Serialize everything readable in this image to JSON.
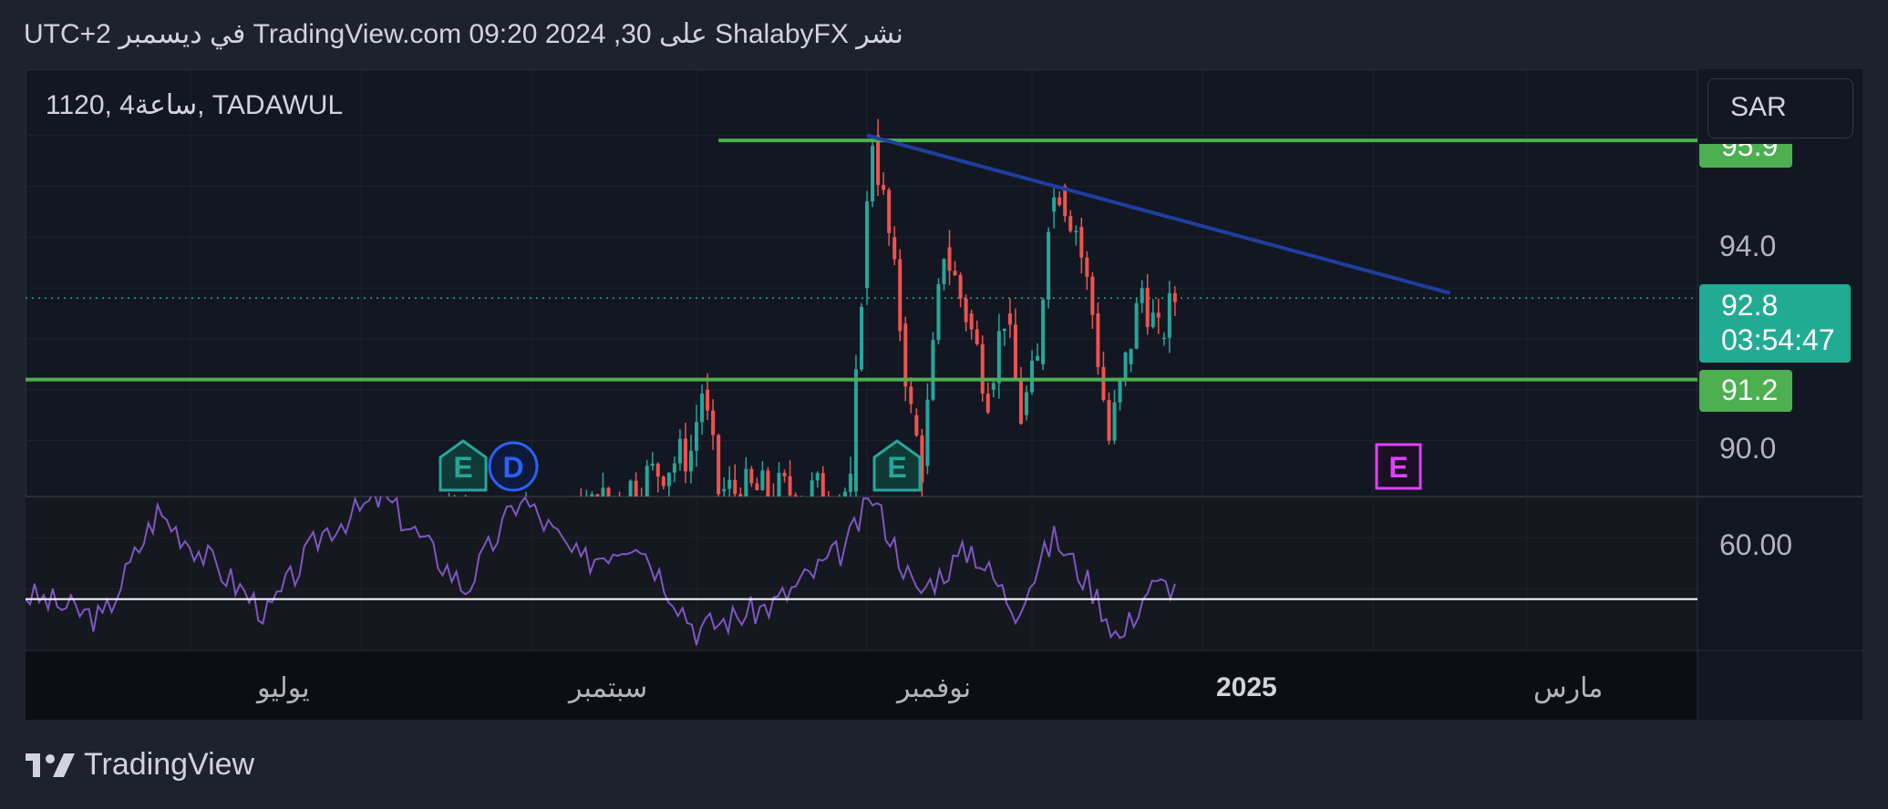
{
  "header": {
    "text": "نشر ShalabyFX على TradingView.com 09:20 2024 ,30 في ديسمبر UTC+2"
  },
  "symbol": {
    "label": "1120, 4ساعة, TADAWUL"
  },
  "currency": {
    "label": "SAR"
  },
  "price_axis": {
    "ticks": [
      "94.0",
      "90.0"
    ],
    "top_tag": "95.9",
    "current_price": "92.8",
    "countdown": "03:54:47",
    "support_tag": "91.2"
  },
  "indicator_axis": {
    "ticks": [
      "60.00"
    ]
  },
  "time_axis": {
    "labels": [
      "يوليو",
      "سبتمبر",
      "نوفمبر",
      "2025",
      "مارس"
    ]
  },
  "event_markers": [
    "E",
    "D",
    "E",
    "E"
  ],
  "footer": {
    "brand": "TradingView"
  },
  "colors": {
    "bull": "#26a69a",
    "bear": "#ef5350",
    "level_line": "#4caf50",
    "trend_line": "#1e3fa0",
    "rsi": "#7e57c2",
    "current_tag": "#22ab94"
  },
  "chart_data": {
    "type": "candlestick",
    "symbol": "1120",
    "exchange": "TADAWUL",
    "timeframe": "4ساعة",
    "currency": "SAR",
    "ylim": [
      88.9,
      97.3
    ],
    "horizontal_levels": [
      95.9,
      91.2
    ],
    "current_price": 92.8,
    "trendline": {
      "from": {
        "x": "2024-11-01",
        "y": 96.0
      },
      "to": {
        "x": "2025-02-15",
        "y": 92.9
      }
    },
    "price_swings": [
      {
        "x": "2024-08-05",
        "y": 88.5
      },
      {
        "x": "2024-09-05",
        "y": 88.2
      },
      {
        "x": "2024-09-30",
        "y": 89.8
      },
      {
        "x": "2024-10-02",
        "y": 91.0
      },
      {
        "x": "2024-10-05",
        "y": 89.0
      },
      {
        "x": "2024-10-29",
        "y": 89.0
      },
      {
        "x": "2024-10-31",
        "y": 93.0
      },
      {
        "x": "2024-11-02",
        "y": 96.0
      },
      {
        "x": "2024-11-05",
        "y": 94.0
      },
      {
        "x": "2024-11-07",
        "y": 92.3
      },
      {
        "x": "2024-11-09",
        "y": 90.5
      },
      {
        "x": "2024-11-11",
        "y": 89.5
      },
      {
        "x": "2024-11-15",
        "y": 93.8
      },
      {
        "x": "2024-11-19",
        "y": 92.5
      },
      {
        "x": "2024-11-23",
        "y": 91.0
      },
      {
        "x": "2024-11-26",
        "y": 92.5
      },
      {
        "x": "2024-11-29",
        "y": 90.5
      },
      {
        "x": "2024-12-02",
        "y": 91.5
      },
      {
        "x": "2024-12-04",
        "y": 94.5
      },
      {
        "x": "2024-12-06",
        "y": 95.0
      },
      {
        "x": "2024-12-09",
        "y": 94.2
      },
      {
        "x": "2024-12-12",
        "y": 92.5
      },
      {
        "x": "2024-12-15",
        "y": 90.0
      },
      {
        "x": "2024-12-18",
        "y": 91.5
      },
      {
        "x": "2024-12-21",
        "y": 93.0
      },
      {
        "x": "2024-12-24",
        "y": 92.0
      },
      {
        "x": "2024-12-27",
        "y": 92.8
      }
    ],
    "rsi": {
      "ylim": [
        38,
        68
      ],
      "reference_level": 48,
      "points": [
        {
          "x": "2024-06-01",
          "y": 49
        },
        {
          "x": "2024-06-15",
          "y": 44
        },
        {
          "x": "2024-06-25",
          "y": 65
        },
        {
          "x": "2024-07-05",
          "y": 55
        },
        {
          "x": "2024-07-15",
          "y": 45
        },
        {
          "x": "2024-07-25",
          "y": 61
        },
        {
          "x": "2024-08-05",
          "y": 68
        },
        {
          "x": "2024-08-20",
          "y": 50
        },
        {
          "x": "2024-08-30",
          "y": 68
        },
        {
          "x": "2024-09-10",
          "y": 55
        },
        {
          "x": "2024-09-20",
          "y": 60
        },
        {
          "x": "2024-10-01",
          "y": 42
        },
        {
          "x": "2024-10-15",
          "y": 47
        },
        {
          "x": "2024-10-28",
          "y": 58
        },
        {
          "x": "2024-11-02",
          "y": 68
        },
        {
          "x": "2024-11-10",
          "y": 49
        },
        {
          "x": "2024-11-20",
          "y": 58
        },
        {
          "x": "2024-11-28",
          "y": 46
        },
        {
          "x": "2024-12-05",
          "y": 60
        },
        {
          "x": "2024-12-12",
          "y": 50
        },
        {
          "x": "2024-12-17",
          "y": 40
        },
        {
          "x": "2024-12-22",
          "y": 50
        },
        {
          "x": "2024-12-27",
          "y": 51
        }
      ]
    }
  }
}
